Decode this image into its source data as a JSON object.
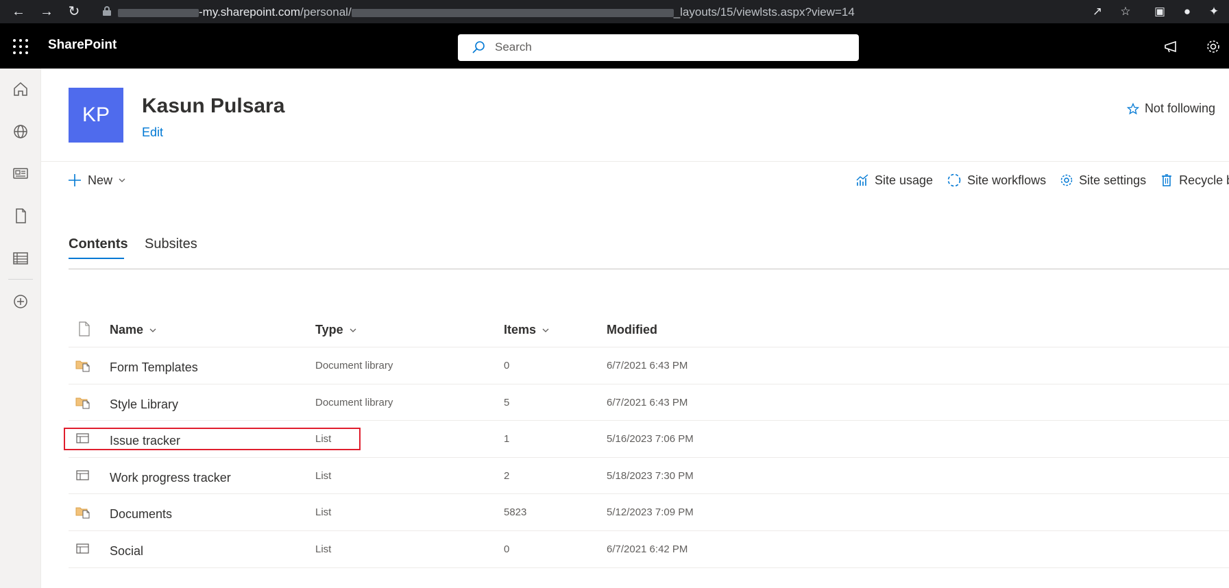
{
  "browser": {
    "url_host": "-my.sharepoint.com",
    "url_path1": "/personal/",
    "url_path2": "_layouts/15/viewlsts.aspx?view=14"
  },
  "header": {
    "brand": "SharePoint",
    "search_placeholder": "Search"
  },
  "site": {
    "logo_initials": "KP",
    "logo_color": "#4f6bed",
    "title": "Kasun Pulsara",
    "edit_label": "Edit",
    "follow_label": "Not following"
  },
  "commands": {
    "new_label": "New",
    "site_usage": "Site usage",
    "site_workflows": "Site workflows",
    "site_settings": "Site settings",
    "recycle_bin": "Recycle bin"
  },
  "tabs": [
    {
      "label": "Contents",
      "active": true
    },
    {
      "label": "Subsites",
      "active": false
    }
  ],
  "table": {
    "columns": {
      "name": "Name",
      "type": "Type",
      "items": "Items",
      "modified": "Modified"
    },
    "rows": [
      {
        "icon": "library-icon",
        "name": "Form Templates",
        "type": "Document library",
        "items": "0",
        "modified": "6/7/2021 6:43 PM"
      },
      {
        "icon": "library-icon",
        "name": "Style Library",
        "type": "Document library",
        "items": "5",
        "modified": "6/7/2021 6:43 PM"
      },
      {
        "icon": "list-icon",
        "name": "Issue tracker",
        "type": "List",
        "items": "1",
        "modified": "5/16/2023 7:06 PM"
      },
      {
        "icon": "list-icon",
        "name": "Work progress tracker",
        "type": "List",
        "items": "2",
        "modified": "5/18/2023 7:30 PM"
      },
      {
        "icon": "library-icon",
        "name": "Documents",
        "type": "List",
        "items": "5823",
        "modified": "5/12/2023 7:09 PM"
      },
      {
        "icon": "list-icon",
        "name": "Social",
        "type": "List",
        "items": "0",
        "modified": "6/7/2021 6:42 PM"
      }
    ]
  },
  "colors": {
    "accent": "#0078d4",
    "highlight_border": "#e01e2d"
  }
}
